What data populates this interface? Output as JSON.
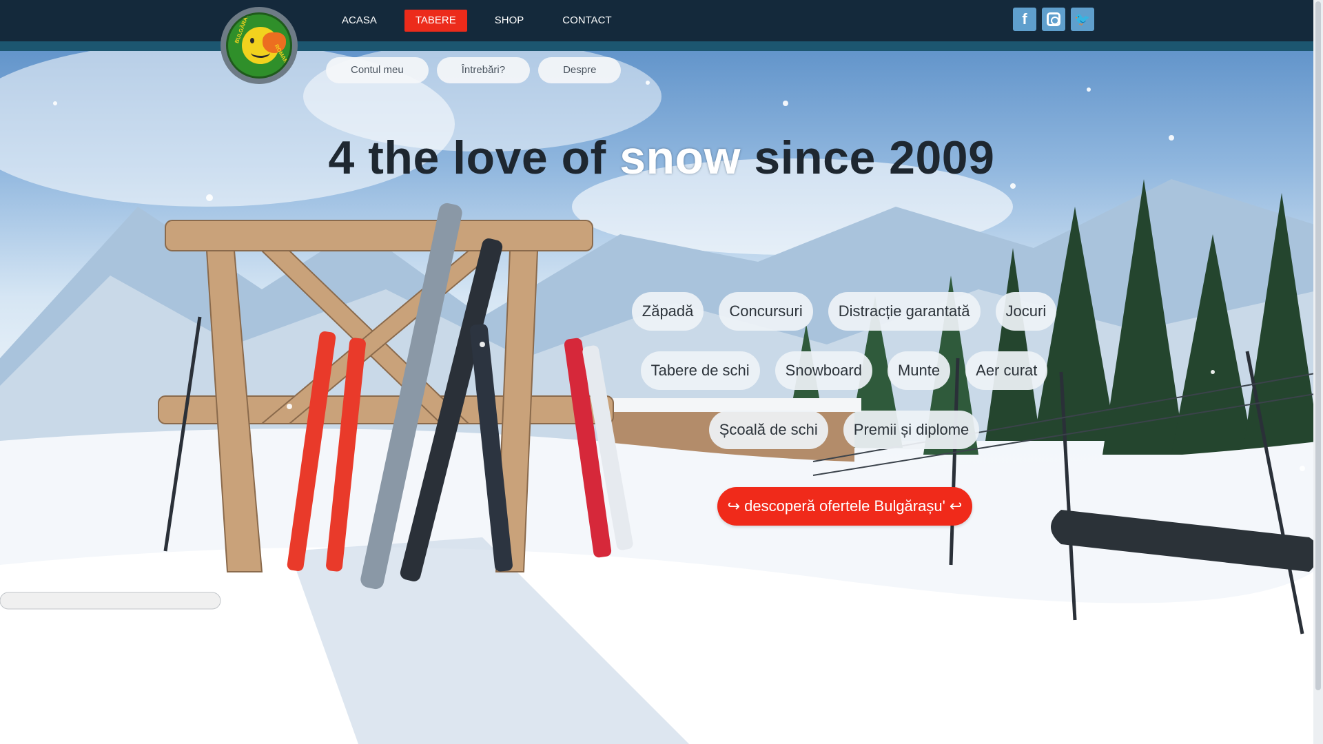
{
  "header": {
    "logo_ring_top": "BULGĂRAȘU",
    "logo_ring_bottom": "ROMANIA",
    "nav": [
      {
        "label": "ACASA",
        "active": false
      },
      {
        "label": "TABERE",
        "active": true
      },
      {
        "label": "SHOP",
        "active": false
      },
      {
        "label": "CONTACT",
        "active": false
      }
    ],
    "social": [
      {
        "icon": "facebook-icon",
        "glyph": "f"
      },
      {
        "icon": "instagram-icon",
        "glyph": ""
      },
      {
        "icon": "twitter-icon",
        "glyph": "🐦"
      }
    ],
    "subnav": [
      "Contul meu",
      "Întrebări?",
      "Despre"
    ]
  },
  "hero": {
    "headline_before": "4 the love of ",
    "headline_accent": "snow",
    "headline_after": " since 2009",
    "tag_rows": [
      [
        "Zăpadă",
        "Concursuri",
        "Distracție garantată",
        "Jocuri"
      ],
      [
        "Tabere de schi",
        "Snowboard",
        "Munte",
        "Aer curat"
      ],
      [
        "Școală de schi",
        "Premii și diplome"
      ]
    ],
    "cta_label": "↪ descoperă ofertele Bulgărașu' ↩"
  },
  "colors": {
    "topbar": "#14293b",
    "active_nav": "#ec2b1b",
    "cta": "#f02a1a",
    "social": "#5f9fcd"
  }
}
